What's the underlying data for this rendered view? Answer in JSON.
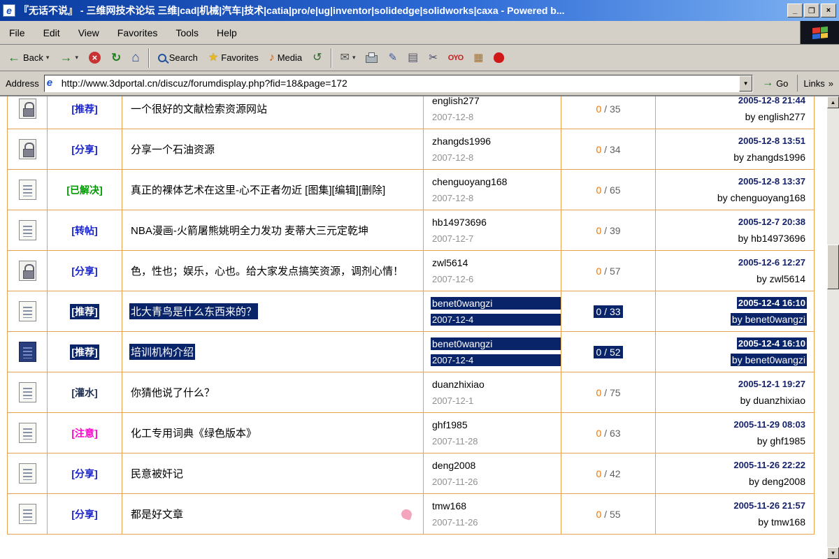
{
  "window": {
    "title": "『无话不说』 - 三维网技术论坛 三维|cad|机械|汽车|技术|catia|pro/e|ug|inventor|solidedge|solidworks|caxa - Powered b...",
    "controls": {
      "minimize": "_",
      "restore": "❐",
      "close": "×"
    }
  },
  "icons": {
    "back": "←",
    "forward": "→",
    "stop": "×",
    "refresh": "↻",
    "home": "⌂",
    "star": "★",
    "media": "♪",
    "history": "↺",
    "mail": "✉",
    "edit": "✎",
    "discuss": "▤",
    "cut": "✂",
    "oyo": "OYO",
    "apps": "▦",
    "dropdown": "▾",
    "up_arrow": "▲",
    "down_arrow": "▼",
    "go_arrow": "→",
    "links_chevron": "»",
    "e_logo": "e"
  },
  "menu": {
    "items": [
      "File",
      "Edit",
      "View",
      "Favorites",
      "Tools",
      "Help"
    ]
  },
  "toolbar": {
    "back": "Back",
    "search": "Search",
    "favorites": "Favorites",
    "media": "Media"
  },
  "address": {
    "label": "Address",
    "url": "http://www.3dportal.cn/discuz/forumdisplay.php?fid=18&page=172",
    "go": "Go",
    "links": "Links"
  },
  "colors": {
    "table_border": "#E8A24F",
    "selection": "#0A246A",
    "replies_number": "#EE7700",
    "tag_blue": "#1822CC",
    "tag_green": "#009900",
    "tag_magenta": "#FF00CC",
    "tag_dark": "#223355"
  },
  "forum": {
    "rows": [
      {
        "icon": "lock",
        "tag": "[推荐]",
        "tag_color": "#1822CC",
        "title": "一个很好的文献检索资源网站",
        "author": "english277",
        "author_date": "2007-12-8",
        "replies": "0",
        "views": "35",
        "last_date": "2005-12-8 21:44",
        "last_by": "by english277",
        "clipped": true
      },
      {
        "icon": "lock",
        "tag": "[分享]",
        "tag_color": "#1822CC",
        "title": "分享一个石油资源",
        "author": "zhangds1996",
        "author_date": "2007-12-8",
        "replies": "0",
        "views": "34",
        "last_date": "2005-12-8 13:51",
        "last_by": "by zhangds1996"
      },
      {
        "icon": "doc",
        "tag": "[已解决]",
        "tag_color": "#009900",
        "title": "真正的裸体艺术在这里-心不正者勿近  [图集][编辑][删除]",
        "author": "chenguoyang168",
        "author_date": "2007-12-8",
        "replies": "0",
        "views": "65",
        "last_date": "2005-12-8 13:37",
        "last_by": "by chenguoyang168"
      },
      {
        "icon": "doc",
        "tag": "[转帖]",
        "tag_color": "#1822CC",
        "title": "NBA漫画-火箭屠熊姚明全力发功 麦蒂大三元定乾坤",
        "author": "hb14973696",
        "author_date": "2007-12-7",
        "replies": "0",
        "views": "39",
        "last_date": "2005-12-7 20:38",
        "last_by": "by hb14973696"
      },
      {
        "icon": "lock",
        "tag": "[分享]",
        "tag_color": "#1822CC",
        "title": "色，性也；娱乐，心也。给大家发点搞笑资源，调剂心情！",
        "author": "zwl5614",
        "author_date": "2007-12-6",
        "replies": "0",
        "views": "57",
        "last_date": "2005-12-6 12:27",
        "last_by": "by zwl5614"
      },
      {
        "icon": "doc",
        "tag": "[推荐]",
        "tag_color": "#1822CC",
        "title": "北大青鸟是什么东西来的？",
        "author": "benet0wangzi",
        "author_date": "2007-12-4",
        "replies": "0",
        "views": "33",
        "last_date": "2005-12-4 16:10",
        "last_by": "by benet0wangzi",
        "selected": true
      },
      {
        "icon": "doc",
        "icon_selected": true,
        "tag": "[推荐]",
        "tag_color": "#1822CC",
        "title": "培训机构介绍",
        "author": "benet0wangzi",
        "author_date": "2007-12-4",
        "replies": "0",
        "views": "52",
        "last_date": "2005-12-4 16:10",
        "last_by": "by benet0wangzi",
        "selected": true
      },
      {
        "icon": "doc",
        "tag": "[灌水]",
        "tag_color": "#223355",
        "title": "你猜他说了什么？",
        "author": "duanzhixiao",
        "author_date": "2007-12-1",
        "replies": "0",
        "views": "75",
        "last_date": "2005-12-1 19:27",
        "last_by": "by duanzhixiao"
      },
      {
        "icon": "doc",
        "tag": "[注意]",
        "tag_color": "#FF00CC",
        "title": "化工专用词典《绿色版本》",
        "author": "ghf1985",
        "author_date": "2007-11-28",
        "replies": "0",
        "views": "63",
        "last_date": "2005-11-29 08:03",
        "last_by": "by ghf1985"
      },
      {
        "icon": "doc",
        "tag": "[分享]",
        "tag_color": "#1822CC",
        "title": "民意被奸记",
        "author": "deng2008",
        "author_date": "2007-11-26",
        "replies": "0",
        "views": "42",
        "last_date": "2005-11-26 22:22",
        "last_by": "by deng2008"
      },
      {
        "icon": "doc",
        "tag": "[分享]",
        "tag_color": "#1822CC",
        "title": "都是好文章",
        "has_thumb": true,
        "author": "tmw168",
        "author_date": "2007-11-26",
        "replies": "0",
        "views": "55",
        "last_date": "2005-11-26 21:57",
        "last_by": "by tmw168"
      }
    ]
  }
}
